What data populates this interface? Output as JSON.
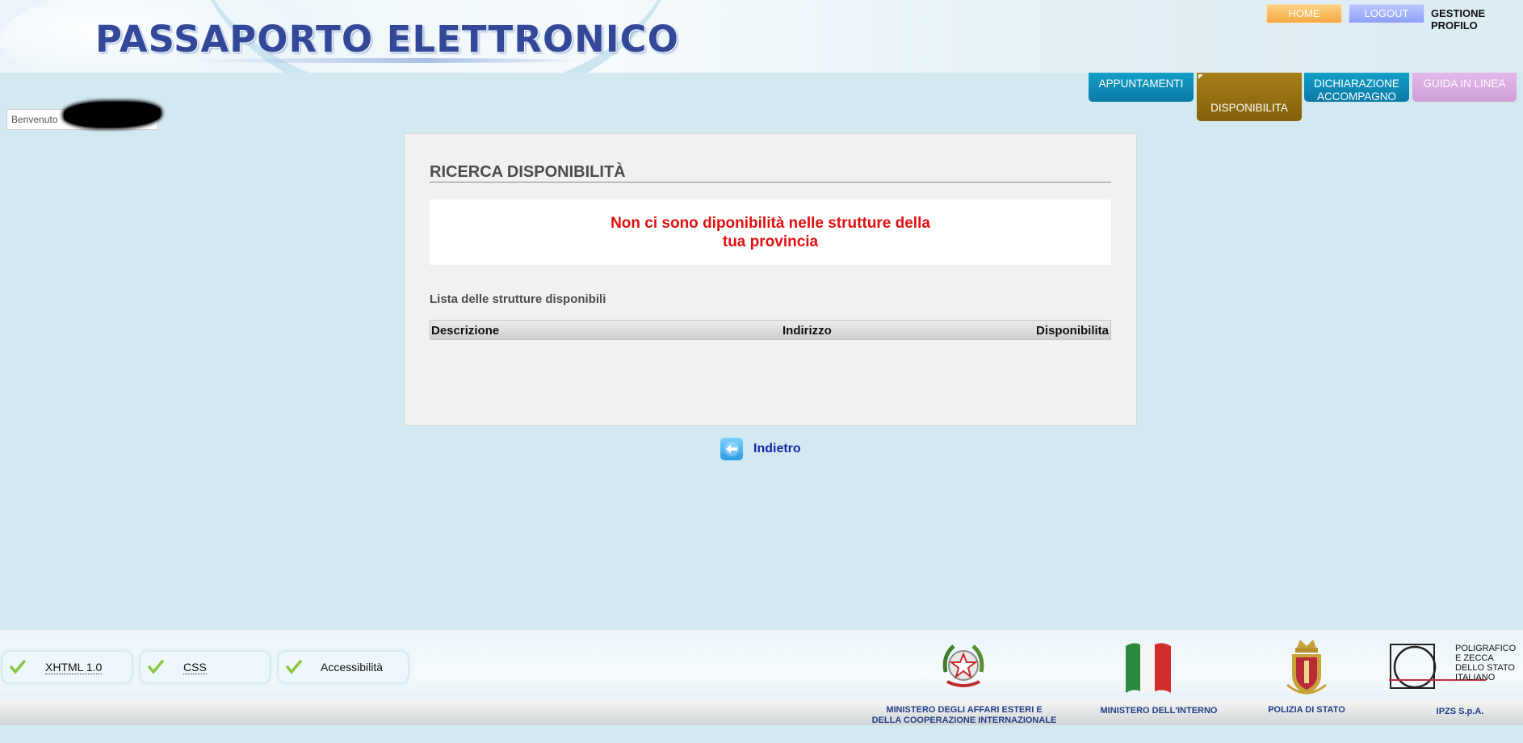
{
  "header": {
    "title": "PASSAPORTO ELETTRONICO",
    "home": "HOME",
    "logout": "LOGOUT",
    "profile": "GESTIONE PROFILO"
  },
  "nav": {
    "appuntamenti": "APPUNTAMENTI",
    "disponibilita": "DISPONIBILITA",
    "dichiarazione_1": "DICHIARAZIONE",
    "dichiarazione_2": "ACCOMPAGNO",
    "guida": "GUIDA IN LINEA"
  },
  "welcome": {
    "label": "Benvenuto"
  },
  "main": {
    "title": "RICERCA DISPONIBILITÀ",
    "message_line1": "Non ci sono diponibilità nelle strutture della",
    "message_line2": "tua provincia",
    "list_label": "Lista delle strutture disponibili",
    "columns": [
      "Descrizione",
      "Indirizzo",
      "Disponibilita"
    ]
  },
  "back": {
    "label": "Indietro"
  },
  "footer": {
    "badges": [
      "XHTML 1.0",
      "CSS",
      "Accessibilità"
    ],
    "logos": {
      "mae_line1": "MINISTERO DEGLI AFFARI ESTERI E",
      "mae_line2": "DELLA COOPERAZIONE INTERNAZIONALE",
      "interno": "MINISTERO DELL'INTERNO",
      "polizia": "POLIZIA DI STATO",
      "ipzs": "IPZS S.p.A.",
      "ipzs_mark": [
        "POLIGRAFICO",
        "E ZECCA",
        "DELLO STATO",
        "ITALIANO"
      ]
    }
  },
  "colors": {
    "background": "#d3e9f1",
    "tab_active": "#a67e17",
    "tab_blue": "#0c79a6",
    "tab_guida": "#cfa0d8",
    "error_text": "#e30e0e",
    "link": "#1226a8"
  }
}
